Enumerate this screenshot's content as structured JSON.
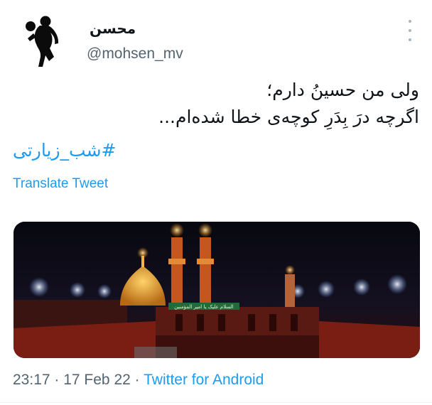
{
  "user": {
    "display_name": "محسن",
    "handle": "@mohsen_mv",
    "avatar_icon": "silhouette-with-ball-icon"
  },
  "tweet": {
    "lines": [
      "ولی من حسینُ دارم؛",
      "اگرچه درَ بِدَرِ کوچه‌ی خطا شده‌ام..."
    ],
    "hashtag": "#شب_زیارتی",
    "translate_label": "Translate Tweet"
  },
  "media": {
    "banner_text": "السلام علیک یا امیر المؤمنین"
  },
  "meta": {
    "time": "23:17",
    "separator": " · ",
    "date": "17 Feb 22",
    "source": "Twitter for Android"
  },
  "colors": {
    "link": "#1d9bf0",
    "text": "#0f1419",
    "muted": "#536471"
  }
}
